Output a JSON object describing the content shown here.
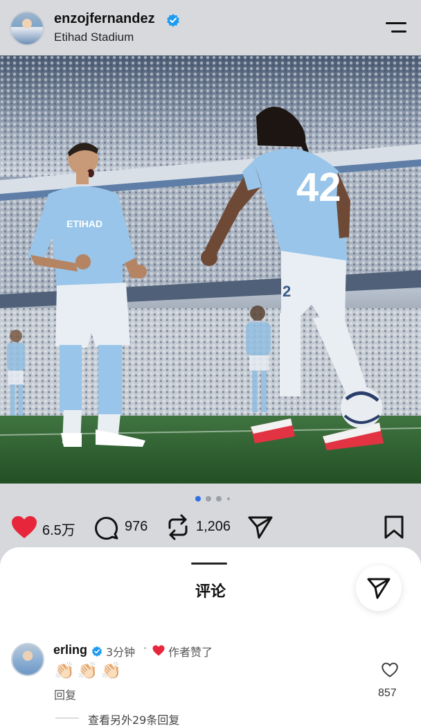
{
  "header": {
    "username": "enzojfernandez",
    "location": "Etihad Stadium"
  },
  "post": {
    "image_alt": "Two Manchester City players celebrating on the pitch",
    "player_number": "42",
    "carousel_dots": 4,
    "carousel_active_index": 0
  },
  "actions": {
    "likes": "6.5万",
    "comments": "976",
    "reposts": "1,206"
  },
  "comments_sheet": {
    "title": "评论",
    "comments": [
      {
        "user": "erling",
        "time": "3分钟",
        "separator": "·",
        "author_liked": "作者赞了",
        "text": "👏🏻👏🏻👏🏻",
        "reply_label": "回复",
        "like_count": "857"
      }
    ],
    "view_more": "查看另外29条回复"
  },
  "colors": {
    "like_red": "#e8263b",
    "verified_blue": "#1d9bf0",
    "city_blue": "#98c5e9"
  }
}
